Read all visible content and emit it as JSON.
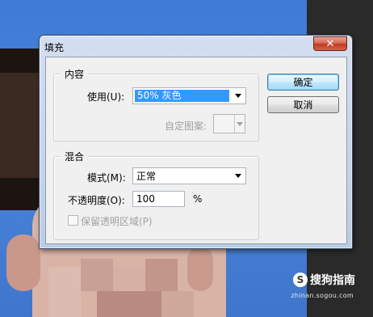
{
  "dialog": {
    "title": "填充",
    "close_glyph": "✕",
    "contents_group": {
      "title": "内容",
      "use_label": "使用(U):",
      "use_value": "50% 灰色",
      "custom_pattern_label": "自定图案:"
    },
    "blending_group": {
      "title": "混合",
      "mode_label": "模式(M):",
      "mode_value": "正常",
      "opacity_label": "不透明度(O):",
      "opacity_value": "100",
      "opacity_unit": "%",
      "preserve_transparency_label": "保留透明区域(P)",
      "preserve_transparency_checked": false
    },
    "buttons": {
      "ok": "确定",
      "cancel": "取消"
    }
  },
  "watermark": {
    "logo_letter": "S",
    "brand": "搜狗指南",
    "url": "zhinan.sogou.com"
  },
  "colors": {
    "background_blue": "#3f7bd6",
    "selection_highlight": "#3399ff",
    "close_button_red": "#c23a22"
  }
}
